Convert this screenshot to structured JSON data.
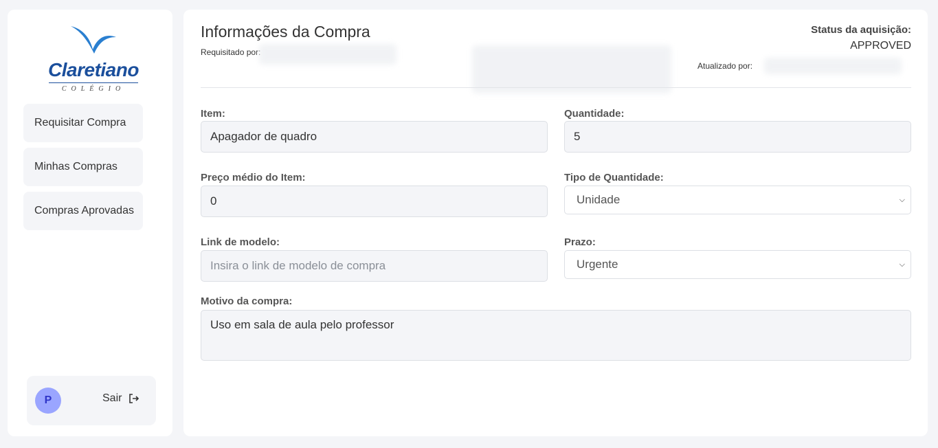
{
  "sidebar": {
    "logo": {
      "word": "Claretiano",
      "sub": "COLÉGIO",
      "brand_color": "#1b4f9c"
    },
    "items": [
      {
        "label": "Requisitar Compra"
      },
      {
        "label": "Minhas Compras"
      },
      {
        "label": "Compras Aprovadas"
      }
    ],
    "user": {
      "avatar_letter": "P",
      "logout_label": "Sair",
      "avatar_color": "#9aa5ff"
    }
  },
  "header": {
    "title": "Informações da Compra",
    "requested_by_label": "Requisitado por:",
    "status_label": "Status da aquisição:",
    "status_value": "APPROVED",
    "updated_by_label": "Atualizado por:"
  },
  "form": {
    "item": {
      "label": "Item:",
      "value": "Apagador de quadro"
    },
    "quantity": {
      "label": "Quantidade:",
      "value": "5"
    },
    "avg_price": {
      "label": "Preço médio do Item:",
      "value": "0"
    },
    "quantity_type": {
      "label": "Tipo de Quantidade:",
      "selected": "Unidade"
    },
    "model_link": {
      "label": "Link de modelo:",
      "placeholder": "Insira o link de modelo de compra"
    },
    "deadline": {
      "label": "Prazo:",
      "selected": "Urgente"
    },
    "reason": {
      "label": "Motivo da compra:",
      "value": "Uso em sala de aula pelo professor"
    }
  }
}
